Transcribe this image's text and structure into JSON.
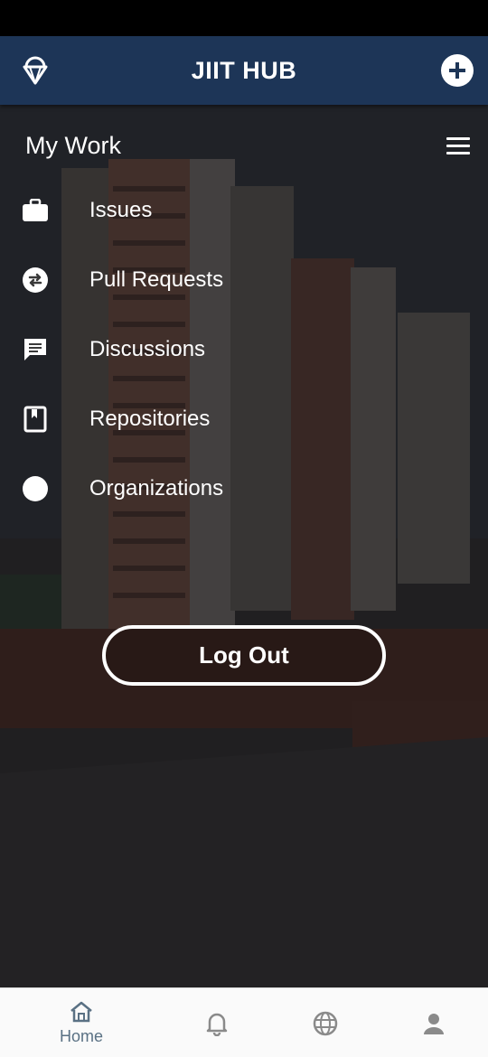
{
  "app": {
    "title": "JIIT HUB"
  },
  "section": {
    "title": "My Work"
  },
  "nav": {
    "issues": "Issues",
    "pull_requests": "Pull Requests",
    "discussions": "Discussions",
    "repositories": "Repositories",
    "organizations": "Organizations"
  },
  "logout": {
    "label": "Log Out"
  },
  "bottom_nav": {
    "home": "Home"
  },
  "colors": {
    "app_bar": "#1d3557",
    "bottom_nav_active": "#5a7184"
  },
  "icons": [
    "logo-icon",
    "add-icon",
    "hamburger-menu-icon",
    "briefcase-icon",
    "swap-arrows-icon",
    "chat-icon",
    "book-icon",
    "circle-icon",
    "home-icon",
    "bell-icon",
    "globe-icon",
    "person-icon"
  ]
}
